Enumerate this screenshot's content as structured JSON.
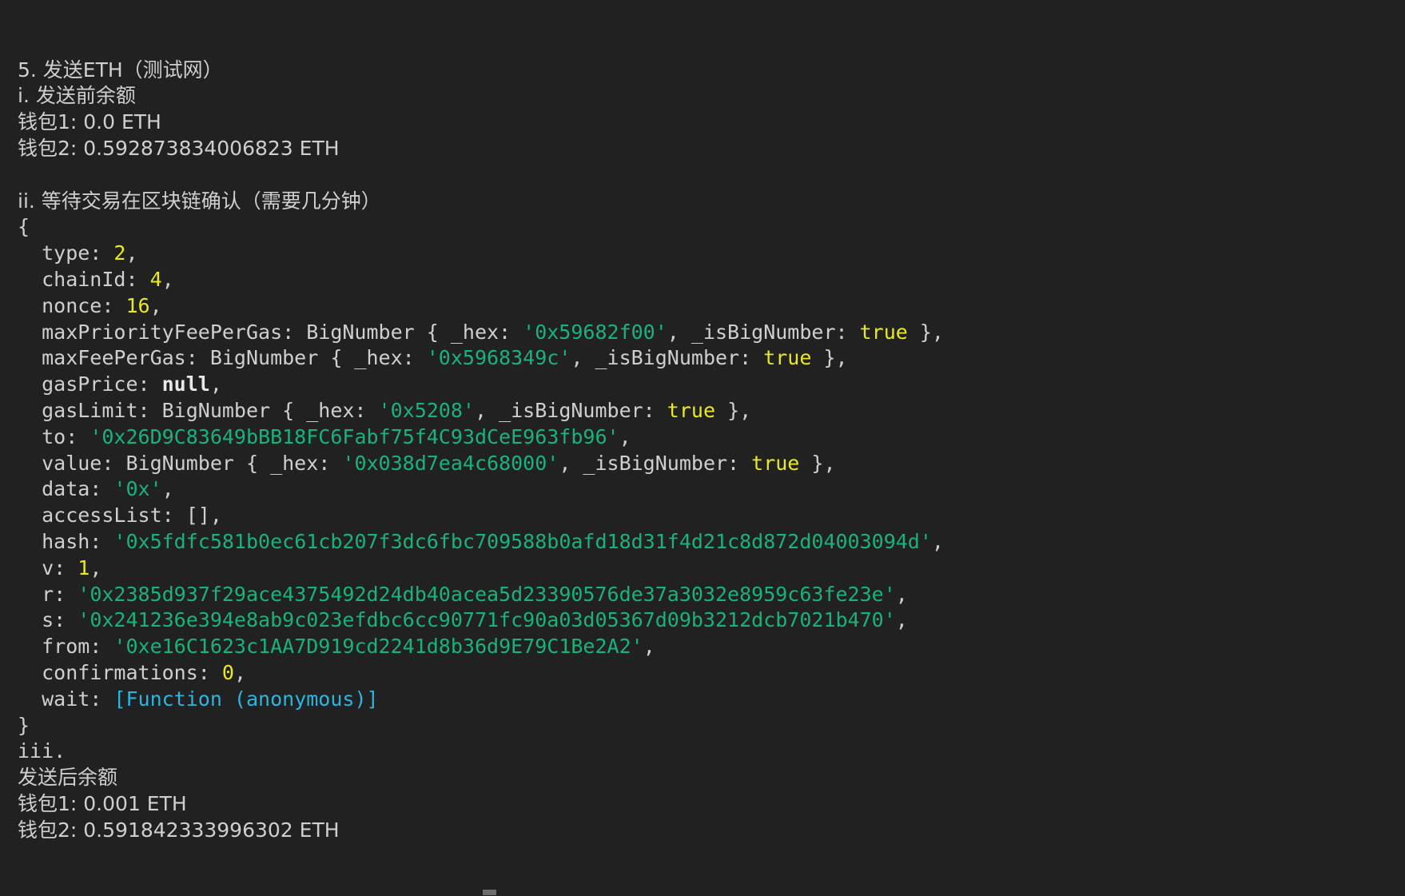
{
  "terminal": {
    "background_color": "#212121",
    "foreground_color": "#cfcfcf",
    "string_color": "#18b37a",
    "number_color": "#e9e921",
    "function_color": "#29b6e0",
    "lines": [
      {
        "id": "heading-section-5",
        "segments": [
          {
            "cls": "plain",
            "text": "5. 发送ETH（测试网）"
          }
        ]
      },
      {
        "id": "heading-i",
        "segments": [
          {
            "cls": "plain",
            "text": "i. 发送前余额"
          }
        ]
      },
      {
        "id": "balance-before-wallet1",
        "segments": [
          {
            "cls": "plain",
            "text": "钱包1: 0.0 ETH"
          }
        ]
      },
      {
        "id": "balance-before-wallet2",
        "segments": [
          {
            "cls": "plain",
            "text": "钱包2: 0.592873834006823 ETH"
          }
        ]
      },
      {
        "id": "blank-1",
        "segments": []
      },
      {
        "id": "heading-ii",
        "segments": [
          {
            "cls": "plain",
            "text": "ii. 等待交易在区块链确认（需要几分钟）"
          }
        ]
      },
      {
        "id": "tx-object-open-brace",
        "segments": [
          {
            "cls": "plain",
            "text": "{"
          }
        ]
      },
      {
        "id": "tx-type",
        "segments": [
          {
            "cls": "plain",
            "text": "  type: "
          },
          {
            "cls": "num",
            "text": "2"
          },
          {
            "cls": "plain",
            "text": ","
          }
        ]
      },
      {
        "id": "tx-chainid",
        "segments": [
          {
            "cls": "plain",
            "text": "  chainId: "
          },
          {
            "cls": "num",
            "text": "4"
          },
          {
            "cls": "plain",
            "text": ","
          }
        ]
      },
      {
        "id": "tx-nonce",
        "segments": [
          {
            "cls": "plain",
            "text": "  nonce: "
          },
          {
            "cls": "num",
            "text": "16"
          },
          {
            "cls": "plain",
            "text": ","
          }
        ]
      },
      {
        "id": "tx-maxpriorityfeepergas",
        "segments": [
          {
            "cls": "plain",
            "text": "  maxPriorityFeePerGas: BigNumber { _hex: "
          },
          {
            "cls": "str",
            "text": "'0x59682f00'"
          },
          {
            "cls": "plain",
            "text": ", _isBigNumber: "
          },
          {
            "cls": "bool",
            "text": "true"
          },
          {
            "cls": "plain",
            "text": " },"
          }
        ]
      },
      {
        "id": "tx-maxfeepergas",
        "segments": [
          {
            "cls": "plain",
            "text": "  maxFeePerGas: BigNumber { _hex: "
          },
          {
            "cls": "str",
            "text": "'0x5968349c'"
          },
          {
            "cls": "plain",
            "text": ", _isBigNumber: "
          },
          {
            "cls": "bool",
            "text": "true"
          },
          {
            "cls": "plain",
            "text": " },"
          }
        ]
      },
      {
        "id": "tx-gasprice",
        "segments": [
          {
            "cls": "plain",
            "text": "  gasPrice: "
          },
          {
            "cls": "nul",
            "text": "null"
          },
          {
            "cls": "plain",
            "text": ","
          }
        ]
      },
      {
        "id": "tx-gaslimit",
        "segments": [
          {
            "cls": "plain",
            "text": "  gasLimit: BigNumber { _hex: "
          },
          {
            "cls": "str",
            "text": "'0x5208'"
          },
          {
            "cls": "plain",
            "text": ", _isBigNumber: "
          },
          {
            "cls": "bool",
            "text": "true"
          },
          {
            "cls": "plain",
            "text": " },"
          }
        ]
      },
      {
        "id": "tx-to",
        "segments": [
          {
            "cls": "plain",
            "text": "  to: "
          },
          {
            "cls": "str",
            "text": "'0x26D9C83649bBB18FC6Fabf75f4C93dCeE963fb96'"
          },
          {
            "cls": "plain",
            "text": ","
          }
        ]
      },
      {
        "id": "tx-value",
        "segments": [
          {
            "cls": "plain",
            "text": "  value: BigNumber { _hex: "
          },
          {
            "cls": "str",
            "text": "'0x038d7ea4c68000'"
          },
          {
            "cls": "plain",
            "text": ", _isBigNumber: "
          },
          {
            "cls": "bool",
            "text": "true"
          },
          {
            "cls": "plain",
            "text": " },"
          }
        ]
      },
      {
        "id": "tx-data",
        "segments": [
          {
            "cls": "plain",
            "text": "  data: "
          },
          {
            "cls": "str",
            "text": "'0x'"
          },
          {
            "cls": "plain",
            "text": ","
          }
        ]
      },
      {
        "id": "tx-accesslist",
        "segments": [
          {
            "cls": "plain",
            "text": "  accessList: [],"
          }
        ]
      },
      {
        "id": "tx-hash",
        "segments": [
          {
            "cls": "plain",
            "text": "  hash: "
          },
          {
            "cls": "str",
            "text": "'0x5fdfc581b0ec61cb207f3dc6fbc709588b0afd18d31f4d21c8d872d04003094d'"
          },
          {
            "cls": "plain",
            "text": ","
          }
        ]
      },
      {
        "id": "tx-v",
        "segments": [
          {
            "cls": "plain",
            "text": "  v: "
          },
          {
            "cls": "num",
            "text": "1"
          },
          {
            "cls": "plain",
            "text": ","
          }
        ]
      },
      {
        "id": "tx-r",
        "segments": [
          {
            "cls": "plain",
            "text": "  r: "
          },
          {
            "cls": "str",
            "text": "'0x2385d937f29ace4375492d24db40acea5d23390576de37a3032e8959c63fe23e'"
          },
          {
            "cls": "plain",
            "text": ","
          }
        ]
      },
      {
        "id": "tx-s",
        "segments": [
          {
            "cls": "plain",
            "text": "  s: "
          },
          {
            "cls": "str",
            "text": "'0x241236e394e8ab9c023efdbc6cc90771fc90a03d05367d09b3212dcb7021b470'"
          },
          {
            "cls": "plain",
            "text": ","
          }
        ]
      },
      {
        "id": "tx-from",
        "segments": [
          {
            "cls": "plain",
            "text": "  from: "
          },
          {
            "cls": "str",
            "text": "'0xe16C1623c1AA7D919cd2241d8b36d9E79C1Be2A2'"
          },
          {
            "cls": "plain",
            "text": ","
          }
        ]
      },
      {
        "id": "tx-confirmations",
        "segments": [
          {
            "cls": "plain",
            "text": "  confirmations: "
          },
          {
            "cls": "num",
            "text": "0"
          },
          {
            "cls": "plain",
            "text": ","
          }
        ]
      },
      {
        "id": "tx-wait",
        "segments": [
          {
            "cls": "plain",
            "text": "  wait: "
          },
          {
            "cls": "fn",
            "text": "[Function (anonymous)]"
          }
        ]
      },
      {
        "id": "tx-object-close-brace",
        "segments": [
          {
            "cls": "plain",
            "text": "}"
          }
        ]
      },
      {
        "id": "heading-iii",
        "segments": [
          {
            "cls": "plain",
            "text": "iii."
          }
        ]
      },
      {
        "id": "heading-balance-after",
        "segments": [
          {
            "cls": "plain",
            "text": "发送后余额"
          }
        ]
      },
      {
        "id": "balance-after-wallet1",
        "segments": [
          {
            "cls": "plain",
            "text": "钱包1: 0.001 ETH"
          }
        ]
      },
      {
        "id": "balance-after-wallet2",
        "segments": [
          {
            "cls": "plain",
            "text": "钱包2: 0.591842333996302 ETH"
          }
        ]
      }
    ]
  }
}
